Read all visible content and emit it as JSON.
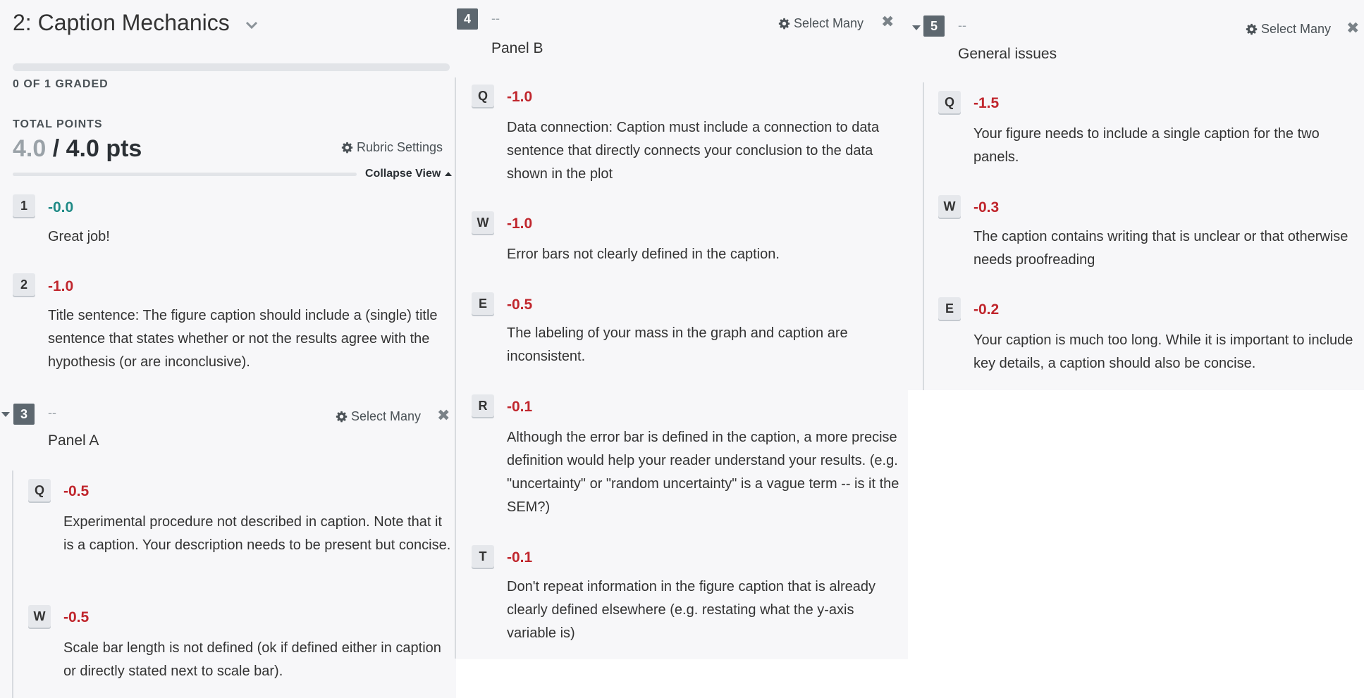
{
  "header": {
    "title": "2: Caption Mechanics",
    "graded": "0 OF 1 GRADED",
    "total_label": "TOTAL POINTS",
    "total_got": "4.0",
    "total_rest": " / 4.0 pts",
    "rubric_settings": "Rubric Settings",
    "collapse_view": "Collapse View"
  },
  "common": {
    "select_many": "Select Many",
    "dash": "--"
  },
  "items": [
    {
      "key": "1",
      "points": "-0.0",
      "text": "Great job!"
    },
    {
      "key": "2",
      "points": "-1.0",
      "text": "Title sentence: The figure caption should include a (single) title sentence that states whether or not the results agree with the hypothesis (or are inconclusive)."
    }
  ],
  "groups": [
    {
      "key": "3",
      "title": "Panel A",
      "items": [
        {
          "key": "Q",
          "points": "-0.5",
          "text": "Experimental procedure not described in caption.  Note that it is a caption. Your description needs to be present but concise."
        },
        {
          "key": "W",
          "points": "-0.5",
          "text": "Scale bar length is not defined (ok if defined either in caption or directly stated next to scale bar)."
        }
      ]
    },
    {
      "key": "4",
      "title": "Panel B",
      "items": [
        {
          "key": "Q",
          "points": "-1.0",
          "text": "Data connection: Caption must include a connection to data sentence that directly connects your conclusion to the data shown in the plot"
        },
        {
          "key": "W",
          "points": "-1.0",
          "text": "Error bars not clearly defined in the caption."
        },
        {
          "key": "E",
          "points": "-0.5",
          "text": "The labeling of your mass in the graph and caption are inconsistent."
        },
        {
          "key": "R",
          "points": "-0.1",
          "text": "Although the error bar is defined in the caption, a more precise definition would help your reader understand your results.  (e.g. \"uncertainty\" or \"random uncertainty\" is a vague term -- is it the SEM?)"
        },
        {
          "key": "T",
          "points": "-0.1",
          "text": "Don't repeat information in the figure caption that is already clearly defined elsewhere (e.g. restating what the y-axis variable is)"
        }
      ]
    },
    {
      "key": "5",
      "title": "General issues",
      "items": [
        {
          "key": "Q",
          "points": "-1.5",
          "text": "Your figure needs to include a single caption for the two panels."
        },
        {
          "key": "W",
          "points": "-0.3",
          "text": "The caption contains writing that is unclear or that otherwise needs proofreading"
        },
        {
          "key": "E",
          "points": "-0.2",
          "text": "Your caption is much too long. While it is important to include key details, a caption should also be concise."
        }
      ]
    }
  ],
  "colors": {
    "negative": "#c0262d",
    "zero": "#1f8a86",
    "group_key_bg": "#5d676f"
  },
  "icons": [
    "gear-icon",
    "chevron-down-icon",
    "caret-up-icon",
    "caret-down-icon",
    "close-icon"
  ]
}
